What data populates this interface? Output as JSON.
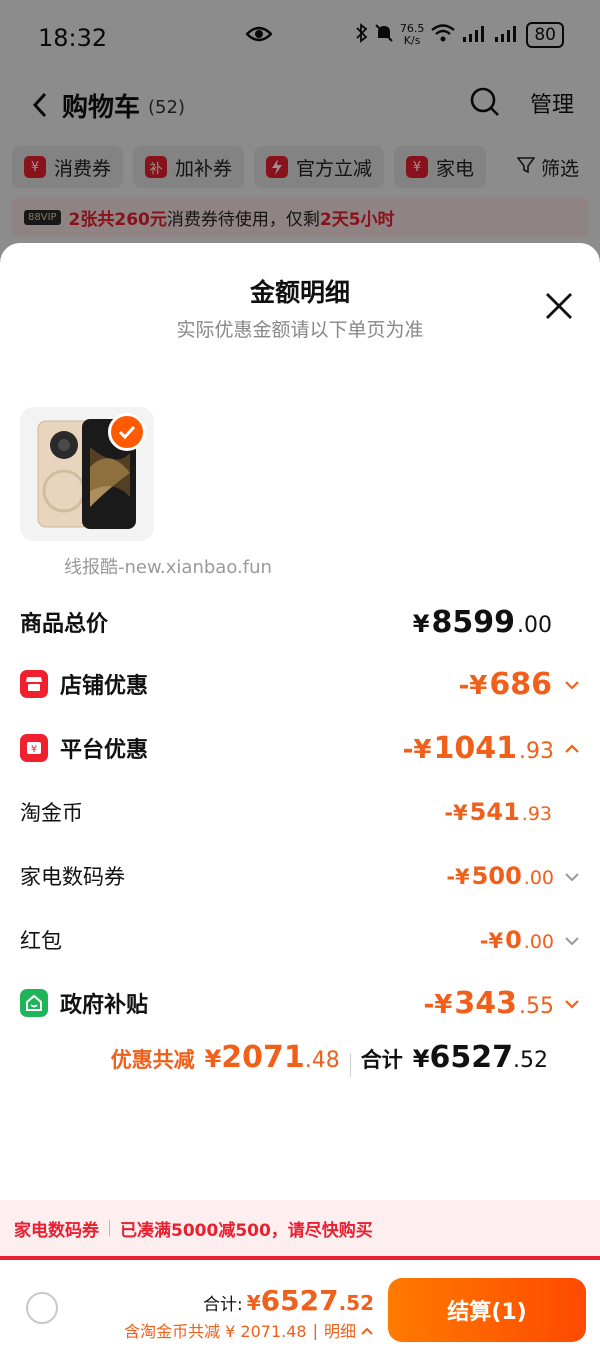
{
  "status_bar": {
    "time": "18:32",
    "net_speed": "76.5",
    "net_unit": "K/s",
    "battery": "80"
  },
  "nav": {
    "title": "购物车",
    "count": "(52)",
    "manage": "管理"
  },
  "filters": [
    {
      "label": "消费券",
      "icon": "coupon-icon"
    },
    {
      "label": "加补券",
      "icon": "subsidy-icon",
      "icon_char": "补"
    },
    {
      "label": "官方立减",
      "icon": "lightning-icon"
    },
    {
      "label": "家电",
      "icon": "coupon-icon"
    }
  ],
  "filter_button": "筛选",
  "promo": {
    "badge": "88VIP",
    "part1": "2张共260元",
    "part2": "消费券待使用，仅剩",
    "part3": "2天5小时"
  },
  "sheet": {
    "title": "金额明细",
    "subtitle": "实际优惠金额请以下单页为准",
    "watermark": "线报酷-new.xianbao.fun"
  },
  "rows": {
    "total_price": {
      "label": "商品总价",
      "currency": "¥",
      "major": "8599",
      "minor": ".00"
    },
    "store_discount": {
      "label": "店铺优惠",
      "currency": "-¥",
      "major": "686",
      "minor": ""
    },
    "platform_discount": {
      "label": "平台优惠",
      "currency": "-¥",
      "major": "1041",
      "minor": ".93"
    },
    "taojinbi": {
      "label": "淘金币",
      "currency": "-¥",
      "major": "541",
      "minor": ".93"
    },
    "appliance_coupon": {
      "label": "家电数码券",
      "currency": "-¥",
      "major": "500",
      "minor": ".00"
    },
    "red_packet": {
      "label": "红包",
      "currency": "-¥",
      "major": "0",
      "minor": ".00"
    },
    "gov_subsidy": {
      "label": "政府补贴",
      "currency": "-¥",
      "major": "343",
      "minor": ".55"
    }
  },
  "summary": {
    "discount_label": "优惠共减",
    "discount_currency": "¥",
    "discount_major": "2071",
    "discount_minor": ".48",
    "total_label": "合计",
    "total_currency": "¥",
    "total_major": "6527",
    "total_minor": ".52"
  },
  "notice": {
    "tag": "家电数码券",
    "text": "已凑满5000减500，请尽快购买"
  },
  "checkout": {
    "total_label": "合计:",
    "currency": "¥",
    "major": "6527",
    "minor": ".52",
    "savings": "含淘金币共减 ¥ 2071.48",
    "detail": "明细",
    "button": "结算(1)"
  },
  "colors": {
    "accent_orange": "#f0601a",
    "brand_red": "#e8202f",
    "gov_green": "#1fb35a"
  }
}
